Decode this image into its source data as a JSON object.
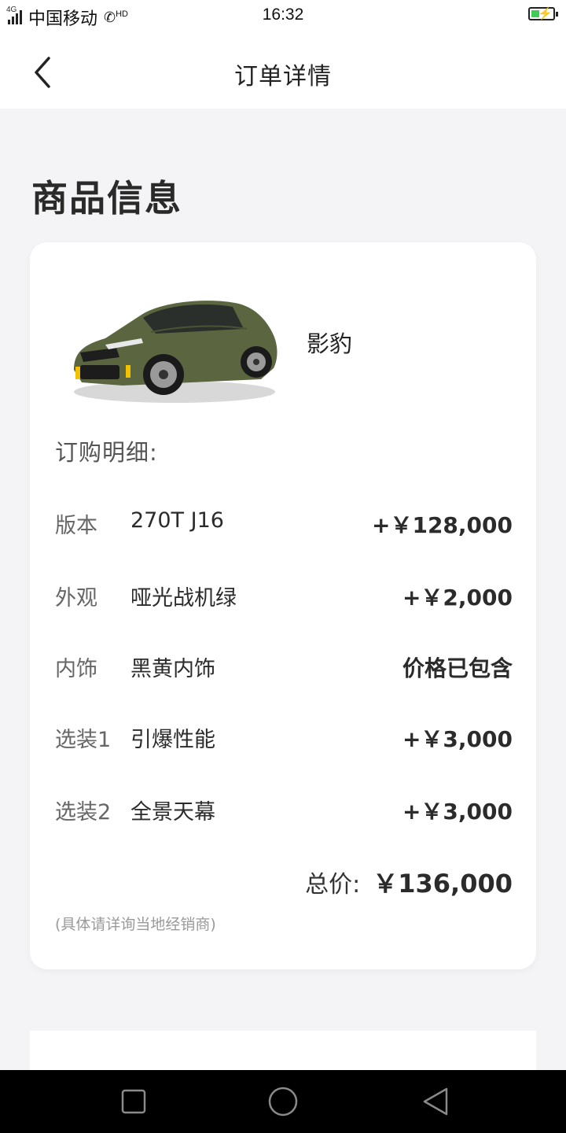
{
  "status_bar": {
    "network_tag": "4G",
    "carrier": "中国移动",
    "hd": "HD",
    "time": "16:32",
    "battery_level_percent": 40
  },
  "nav": {
    "title": "订单详情",
    "back_icon": "chevron-left-icon"
  },
  "section": {
    "title": "商品信息"
  },
  "product": {
    "name": "影豹",
    "image_icon": "car-image",
    "car_color": "#5b6640"
  },
  "order": {
    "heading": "订购明细:",
    "rows": [
      {
        "label": "版本",
        "value": "270T J16",
        "price": "+￥128,000"
      },
      {
        "label": "外观",
        "value": "哑光战机绿",
        "price": "+￥2,000"
      },
      {
        "label": "内饰",
        "value": "黑黄内饰",
        "price": "价格已包含"
      },
      {
        "label": "选装1",
        "value": "引爆性能",
        "price": "+￥3,000"
      },
      {
        "label": "选装2",
        "value": "全景天幕",
        "price": "+￥3,000"
      }
    ],
    "total_label": "总价:",
    "total_price": "￥136,000",
    "note": "(具体请详询当地经销商)"
  },
  "system_nav": {
    "recent_icon": "square-icon",
    "home_icon": "circle-icon",
    "back_icon": "triangle-back-icon"
  },
  "colors": {
    "background": "#f4f4f6",
    "card": "#ffffff",
    "text": "#222222",
    "muted": "#9a9a9a",
    "battery": "#3ecb5a"
  }
}
